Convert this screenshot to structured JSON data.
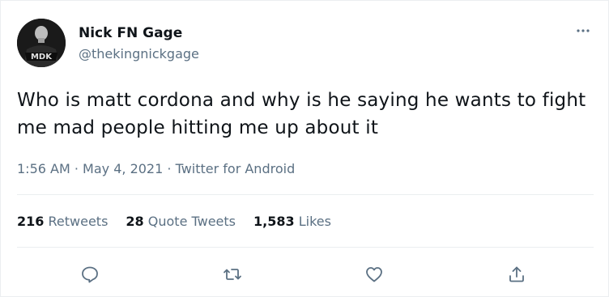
{
  "tweet": {
    "author": {
      "display_name": "Nick FN Gage",
      "handle": "@thekingnickgage",
      "avatar_text": "MDK"
    },
    "text": "Who is matt cordona and why is he saying he wants to fight me mad people hitting me up about it",
    "time": "1:56 AM",
    "separator": "·",
    "date": "May 4, 2021",
    "source": "Twitter for Android",
    "stats": {
      "retweets_count": "216",
      "retweets_label": "Retweets",
      "quote_tweets_count": "28",
      "quote_tweets_label": "Quote Tweets",
      "likes_count": "1,583",
      "likes_label": "Likes"
    }
  },
  "icons": {
    "more": "more-horizontal-icon",
    "reply": "reply-icon",
    "retweet": "retweet-icon",
    "like": "heart-icon",
    "share": "share-icon"
  },
  "colors": {
    "text_primary": "#0f1419",
    "text_secondary": "#5b7083",
    "divider": "#ebeef0"
  }
}
